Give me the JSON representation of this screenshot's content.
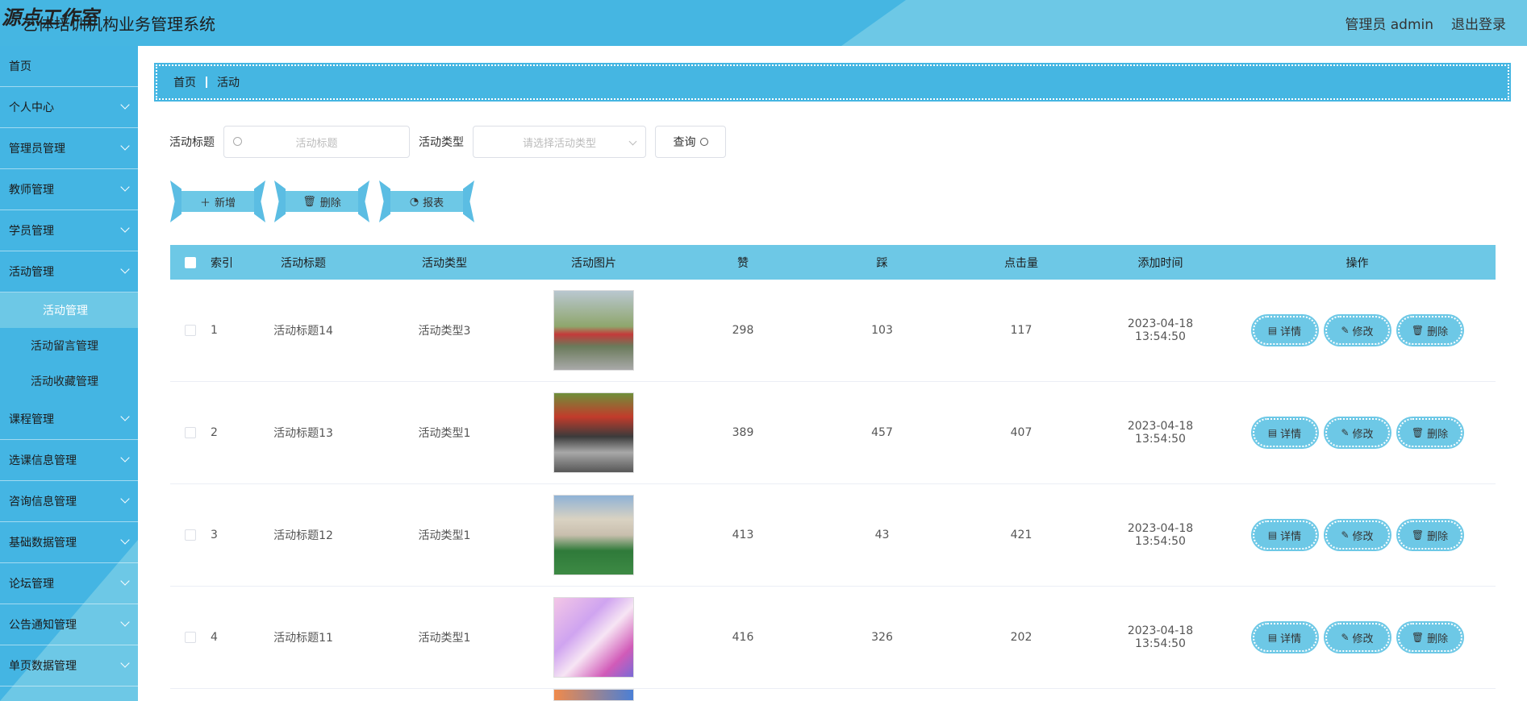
{
  "watermark": "源点工作室",
  "app_title": "艺体培训机构业务管理系统",
  "header": {
    "user": "管理员 admin",
    "logout": "退出登录"
  },
  "sidebar": {
    "items": [
      {
        "label": "首页",
        "chevron": false
      },
      {
        "label": "个人中心",
        "chevron": true
      },
      {
        "label": "管理员管理",
        "chevron": true
      },
      {
        "label": "教师管理",
        "chevron": true
      },
      {
        "label": "学员管理",
        "chevron": true
      },
      {
        "label": "活动管理",
        "chevron": true,
        "open": true
      },
      {
        "label": "课程管理",
        "chevron": true
      },
      {
        "label": "选课信息管理",
        "chevron": true
      },
      {
        "label": "咨询信息管理",
        "chevron": true
      },
      {
        "label": "基础数据管理",
        "chevron": true
      },
      {
        "label": "论坛管理",
        "chevron": true
      },
      {
        "label": "公告通知管理",
        "chevron": true
      },
      {
        "label": "单页数据管理",
        "chevron": true
      }
    ],
    "sub_items": [
      "活动管理",
      "活动留言管理",
      "活动收藏管理"
    ]
  },
  "breadcrumb": {
    "home": "首页",
    "current": "活动"
  },
  "search": {
    "title_label": "活动标题",
    "title_placeholder": "活动标题",
    "type_label": "活动类型",
    "type_placeholder": "请选择活动类型",
    "query_label": "查询"
  },
  "actions": {
    "add": "新增",
    "delete": "删除",
    "report": "报表"
  },
  "table": {
    "headers": [
      "索引",
      "活动标题",
      "活动类型",
      "活动图片",
      "赞",
      "踩",
      "点击量",
      "添加时间",
      "操作"
    ],
    "rows": [
      {
        "index": "1",
        "title": "活动标题14",
        "type": "活动类型3",
        "like": "298",
        "dislike": "103",
        "clicks": "117",
        "time": "2023-04-18 13:54:50"
      },
      {
        "index": "2",
        "title": "活动标题13",
        "type": "活动类型1",
        "like": "389",
        "dislike": "457",
        "clicks": "407",
        "time": "2023-04-18 13:54:50"
      },
      {
        "index": "3",
        "title": "活动标题12",
        "type": "活动类型1",
        "like": "413",
        "dislike": "43",
        "clicks": "421",
        "time": "2023-04-18 13:54:50"
      },
      {
        "index": "4",
        "title": "活动标题11",
        "type": "活动类型1",
        "like": "416",
        "dislike": "326",
        "clicks": "202",
        "time": "2023-04-18 13:54:50"
      }
    ],
    "row_ops": {
      "detail": "详情",
      "edit": "修改",
      "delete": "删除"
    }
  }
}
